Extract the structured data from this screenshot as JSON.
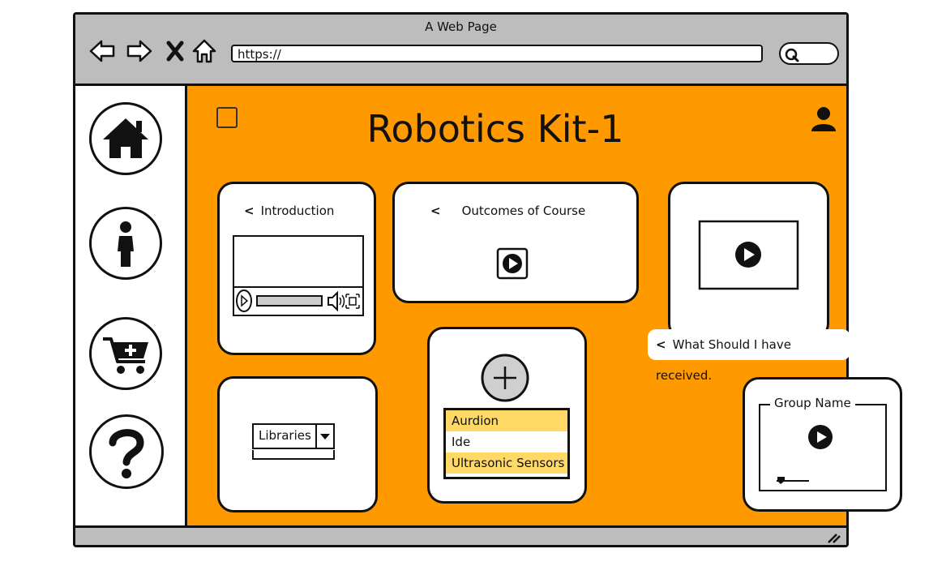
{
  "window": {
    "title": "A Web Page"
  },
  "browser": {
    "url": "https://"
  },
  "page": {
    "title": "Robotics Kit-1"
  },
  "cards": {
    "introduction": {
      "label": "Introduction"
    },
    "outcomes": {
      "label": "Outcomes of Course"
    },
    "received": {
      "label": "What Should I have received."
    },
    "libraries": {
      "selected": "Libraries"
    },
    "topics": {
      "items": [
        "Aurdion",
        "Ide",
        "Ultrasonic Sensors"
      ]
    },
    "group": {
      "label": "Group Name"
    }
  },
  "colors": {
    "accent": "#ff9900",
    "highlight": "#ffd966",
    "chrome": "#bdbdbd"
  },
  "icons": {
    "sidebar": [
      "home-icon",
      "person-icon",
      "cart-add-icon",
      "help-icon"
    ]
  }
}
